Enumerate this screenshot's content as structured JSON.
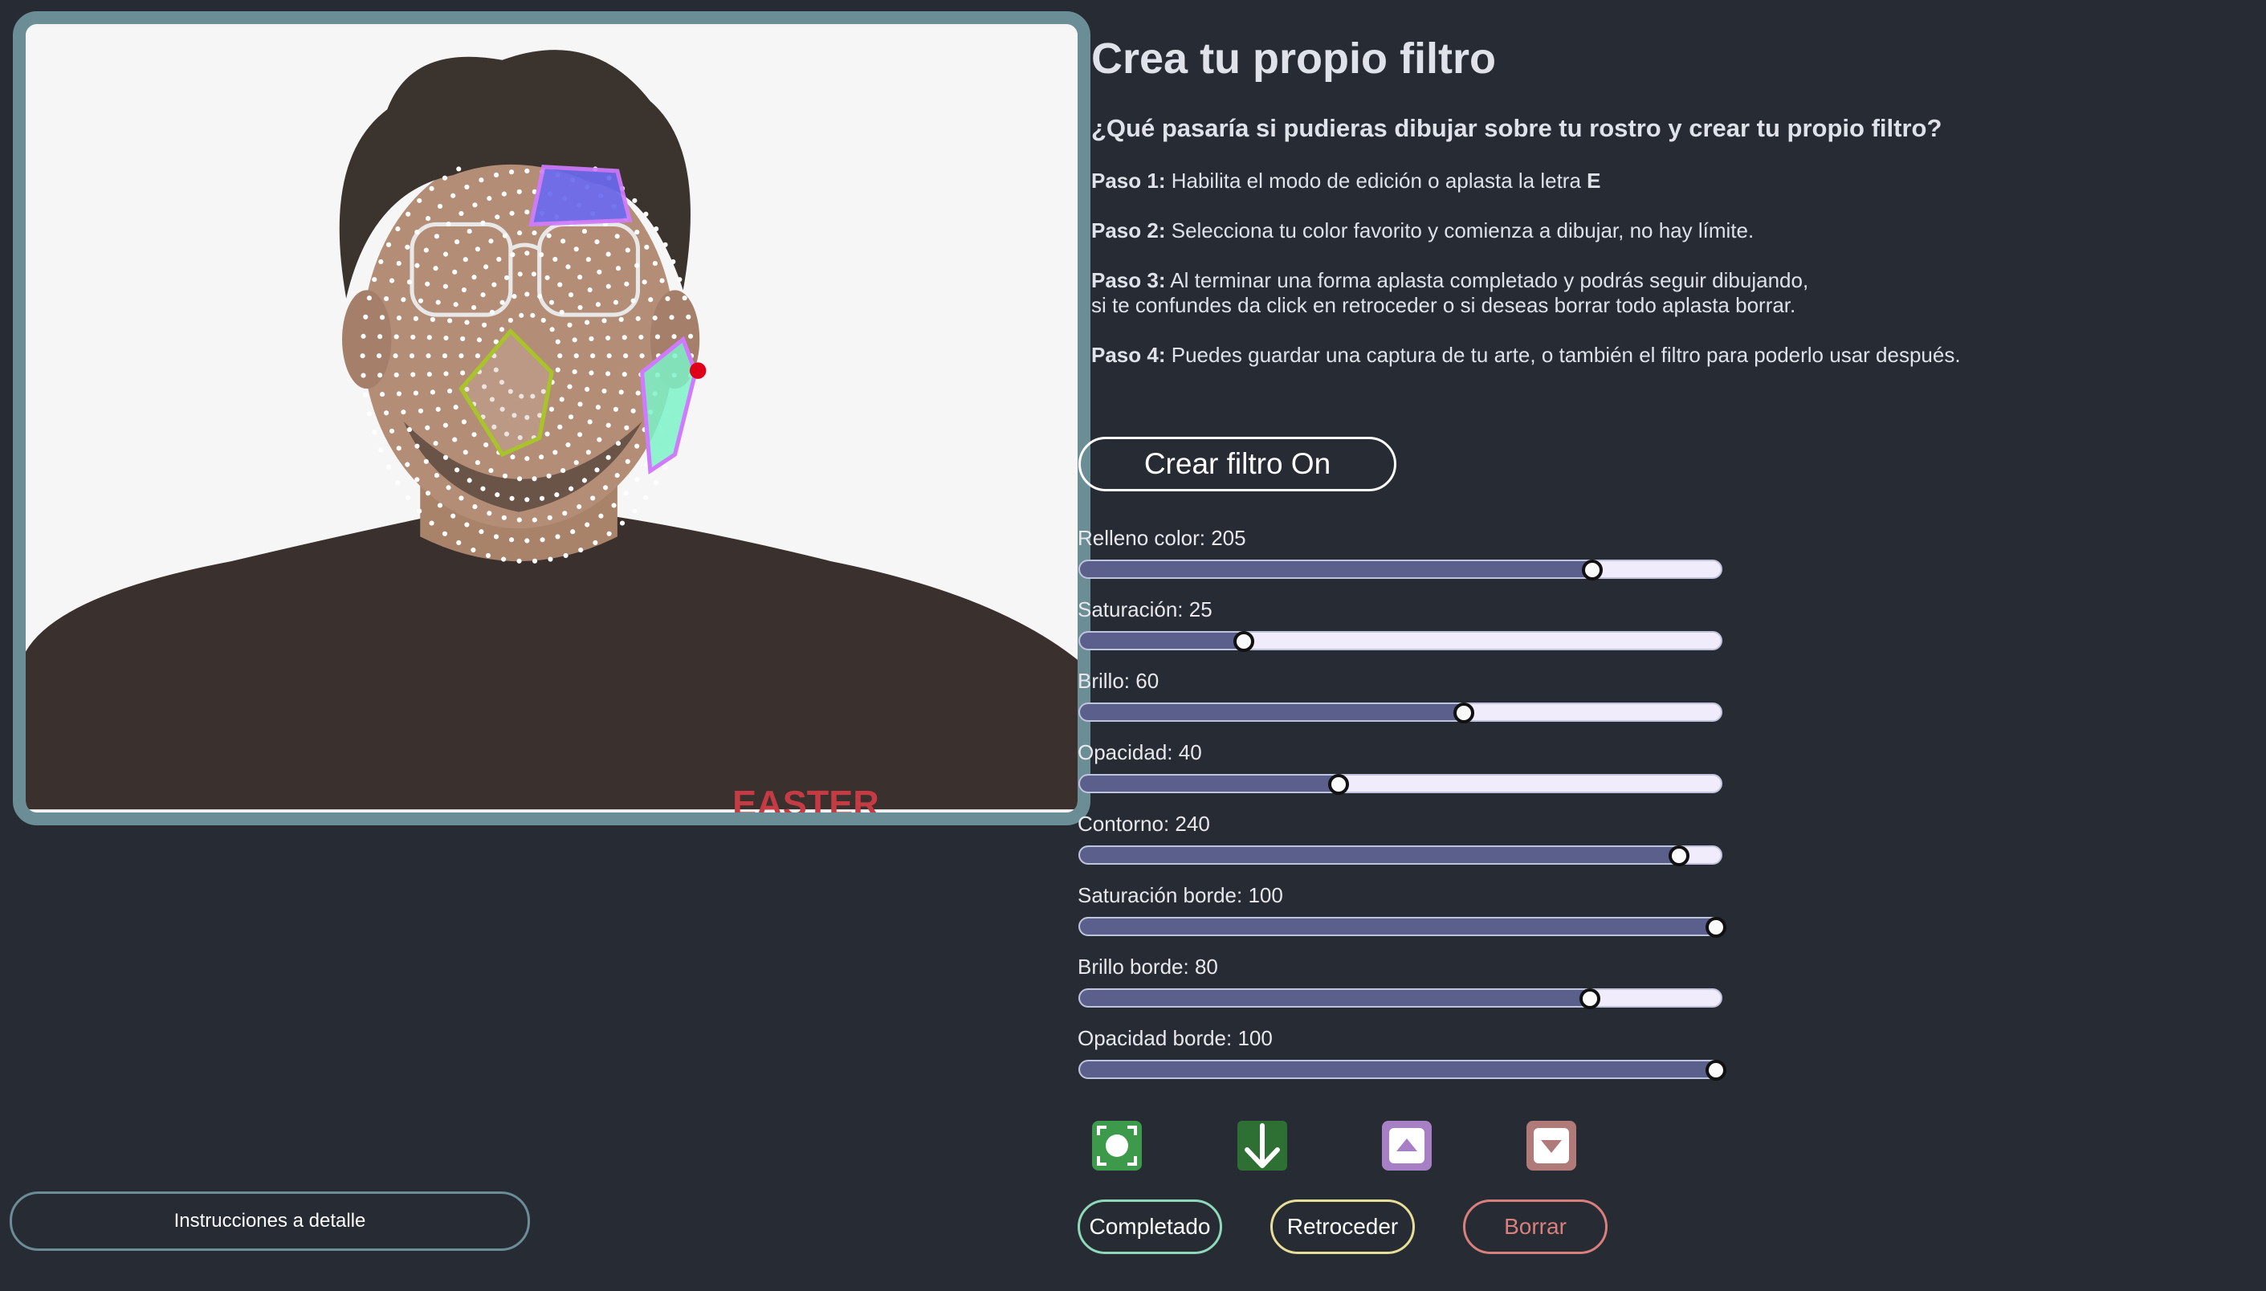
{
  "intro": {
    "title": "Crea tu propio filtro",
    "subtitle": "¿Qué pasaría si pudieras dibujar sobre tu rostro y crear tu propio filtro?",
    "steps": [
      {
        "label": "Paso 1:",
        "text": " Habilita el modo de edición o aplasta la letra ",
        "key": "E"
      },
      {
        "label": "Paso 2:",
        "text": " Selecciona tu color favorito y comienza a dibujar, no hay límite."
      },
      {
        "label": "Paso 3:",
        "text": " Al terminar una forma aplasta completado y podrás seguir dibujando,",
        "text2": "si te confundes da click en retroceder o si deseas borrar todo aplasta borrar."
      },
      {
        "label": "Paso 4:",
        "text": " Puedes guardar una captura de tu arte, o también el filtro para poderlo usar después."
      }
    ]
  },
  "camera": {
    "shirt_text": "EASTER"
  },
  "controls": {
    "toggle_label": "Crear filtro On",
    "sliders": [
      {
        "label": "Relleno color: 205",
        "value": 205,
        "max": 255
      },
      {
        "label": "Saturación: 25",
        "value": 25,
        "max": 100
      },
      {
        "label": "Brillo: 60",
        "value": 60,
        "max": 100
      },
      {
        "label": "Opacidad: 40",
        "value": 40,
        "max": 100
      },
      {
        "label": "Contorno: 240",
        "value": 240,
        "max": 255
      },
      {
        "label": "Saturación borde: 100",
        "value": 100,
        "max": 100
      },
      {
        "label": "Brillo borde: 80",
        "value": 80,
        "max": 100
      },
      {
        "label": "Opacidad borde: 100",
        "value": 100,
        "max": 100
      }
    ],
    "icons": [
      {
        "name": "screenshot-icon",
        "color": "#3c9a4a"
      },
      {
        "name": "download-icon",
        "color": "#2e6f34"
      },
      {
        "name": "upload-icon",
        "color": "#a77fc5"
      },
      {
        "name": "load-icon",
        "color": "#b07a78"
      }
    ],
    "completed_label": "Completado",
    "back_label": "Retroceder",
    "clear_label": "Borrar",
    "colors": {
      "completed": "#8fd9b8",
      "back": "#e9de98",
      "clear": "#d9807c"
    }
  },
  "footer": {
    "instructions_label": "Instrucciones a detalle"
  }
}
